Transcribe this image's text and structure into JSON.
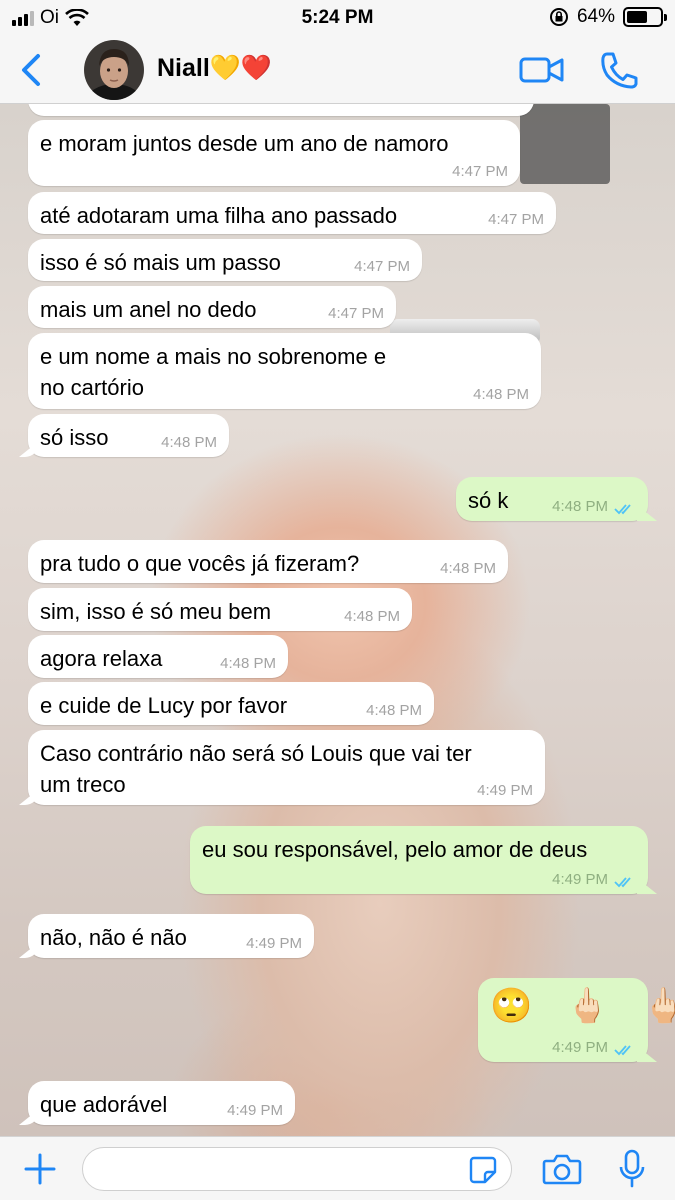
{
  "status_bar": {
    "carrier": "Oi",
    "time": "5:24 PM",
    "battery_percent": "64%",
    "battery_level": 0.64,
    "signal_bars": 3,
    "icons": [
      "signal-icon",
      "wifi-icon",
      "rotation-lock-icon",
      "battery-icon"
    ]
  },
  "header": {
    "contact_name": "Niall",
    "name_emojis": "💛❤️",
    "icons": [
      "back-chevron-icon",
      "avatar",
      "video-call-icon",
      "phone-icon"
    ]
  },
  "colors": {
    "accent": "#1f86f5",
    "outgoing_bubble": "#dcf8c6",
    "incoming_bubble": "#ffffff",
    "read_ticks": "#4fc3f7"
  },
  "messages": [
    {
      "dir": "in",
      "text": "e moram juntos desde um ano de namoro",
      "time": "4:47 PM"
    },
    {
      "dir": "in",
      "text": "até adotaram uma filha ano passado",
      "time": "4:47 PM"
    },
    {
      "dir": "in",
      "text": "isso é só mais um passo",
      "time": "4:47 PM"
    },
    {
      "dir": "in",
      "text": "mais um anel no dedo",
      "time": "4:47 PM"
    },
    {
      "dir": "in",
      "text": [
        "e um nome a mais no sobrenome e",
        "no cartório"
      ],
      "time": "4:48 PM"
    },
    {
      "dir": "in",
      "text": "só isso",
      "time": "4:48 PM"
    },
    {
      "dir": "out",
      "text": "só k",
      "time": "4:48 PM",
      "read": true
    },
    {
      "dir": "in",
      "text": "pra tudo o que vocês já fizeram?",
      "time": "4:48 PM"
    },
    {
      "dir": "in",
      "text": "sim, isso é só meu bem",
      "time": "4:48 PM"
    },
    {
      "dir": "in",
      "text": "agora relaxa",
      "time": "4:48 PM"
    },
    {
      "dir": "in",
      "text": "e cuide de Lucy por favor",
      "time": "4:48 PM"
    },
    {
      "dir": "in",
      "text": [
        "Caso contrário não será só Louis que vai ter",
        "um treco"
      ],
      "time": "4:49 PM"
    },
    {
      "dir": "out",
      "text": "eu sou responsável, pelo amor de deus",
      "time": "4:49 PM",
      "read": true
    },
    {
      "dir": "in",
      "text": "não, não é não",
      "time": "4:49 PM"
    },
    {
      "dir": "out",
      "emojis": [
        "🙄",
        "🖕🏻",
        "🖕🏻"
      ],
      "time": "4:49 PM",
      "read": true
    },
    {
      "dir": "in",
      "text": "que adorável",
      "time": "4:49 PM"
    }
  ],
  "input_bar": {
    "placeholder": "",
    "icons": [
      "plus-icon",
      "sticker-icon",
      "camera-icon",
      "microphone-icon"
    ]
  }
}
